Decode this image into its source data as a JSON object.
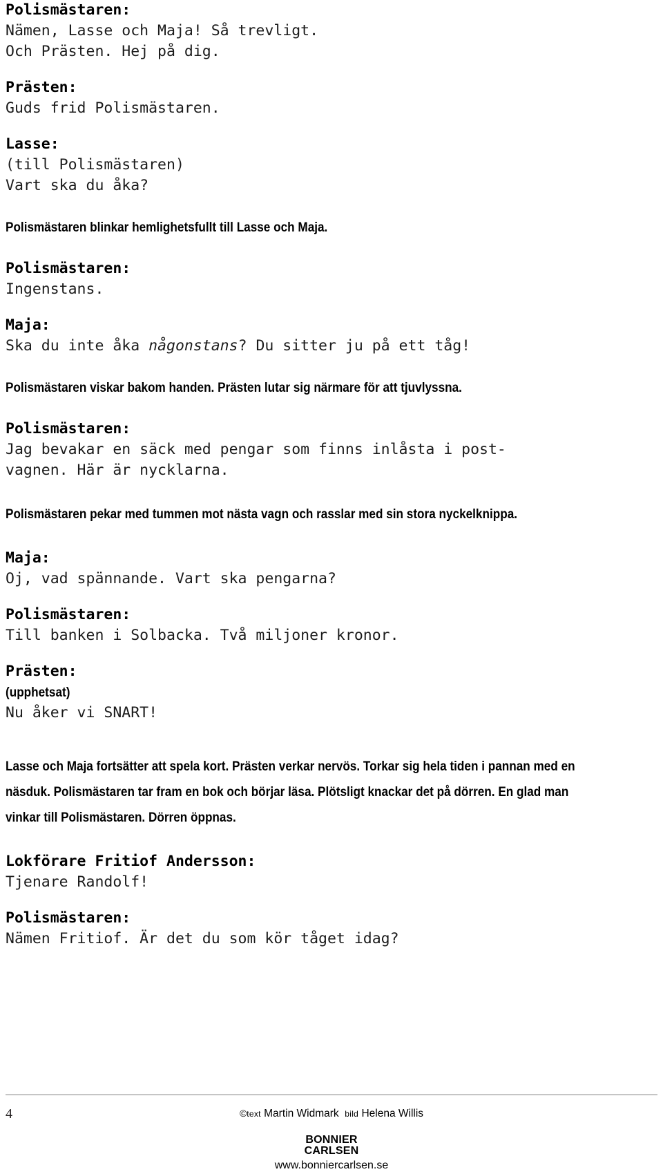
{
  "document": {
    "blocks": [
      {
        "kind": "speaker",
        "text": "Polismästaren:"
      },
      {
        "kind": "line",
        "text": "Nämen, Lasse och Maja! Så trevligt."
      },
      {
        "kind": "line",
        "text": "Och Prästen. Hej på dig."
      },
      {
        "kind": "speaker",
        "text": "Prästen:"
      },
      {
        "kind": "line",
        "text": "Guds frid Polismästaren."
      },
      {
        "kind": "speaker",
        "text": "Lasse:"
      },
      {
        "kind": "line",
        "text": "(till Polismästaren)"
      },
      {
        "kind": "line",
        "text": "Vart ska du åka?"
      },
      {
        "kind": "stage",
        "text": "Polismästaren blinkar hemlighetsfullt till Lasse och Maja."
      },
      {
        "kind": "speaker",
        "text": "Polismästaren:"
      },
      {
        "kind": "line",
        "text": "Ingenstans."
      },
      {
        "kind": "speaker",
        "text": "Maja:"
      },
      {
        "kind": "line_italic",
        "pre": "Ska du inte åka ",
        "em": "någonstans",
        "post": "? Du sitter ju på ett tåg!"
      },
      {
        "kind": "stage",
        "text": "Polismästaren viskar bakom handen. Prästen lutar sig närmare för att tjuvlyssna."
      },
      {
        "kind": "speaker",
        "text": "Polismästaren:"
      },
      {
        "kind": "line",
        "text": "Jag bevakar en säck med pengar som finns inlåsta i post-"
      },
      {
        "kind": "line",
        "text": "vagnen. Här är nycklarna."
      },
      {
        "kind": "stage",
        "text": "Polismästaren pekar med tummen mot nästa vagn och rasslar med sin stora nyckelknippa."
      },
      {
        "kind": "speaker",
        "text": "Maja:"
      },
      {
        "kind": "line",
        "text": "Oj, vad spännande. Vart ska pengarna?"
      },
      {
        "kind": "speaker",
        "text": "Polismästaren:"
      },
      {
        "kind": "line",
        "text": "Till banken i Solbacka. Två miljoner kronor."
      },
      {
        "kind": "speaker",
        "text": "Prästen:"
      },
      {
        "kind": "stage",
        "text": "(upphetsat)"
      },
      {
        "kind": "line",
        "text": "Nu åker vi SNART!"
      },
      {
        "kind": "stage",
        "text": "Lasse och Maja fortsätter att spela kort. Prästen verkar nervös. Torkar sig hela tiden i pannan med en näsduk. Polismästaren tar fram en bok och börjar läsa. Plötsligt knackar det på dörren. En glad man vinkar till Polismästaren. Dörren öppnas."
      },
      {
        "kind": "speaker",
        "text": "Lokförare Fritiof Andersson:"
      },
      {
        "kind": "line",
        "text": "Tjenare Randolf!"
      },
      {
        "kind": "speaker",
        "text": "Polismästaren:"
      },
      {
        "kind": "line",
        "text": "Nämen Fritiof. Är det du som kör tåget idag?"
      }
    ]
  },
  "footer": {
    "page_number": "4",
    "copyright_symbol": "©",
    "credit_text_label": "text",
    "credit_text_author": "Martin Widmark",
    "credit_bild_label": "bild",
    "credit_bild_author": "Helena Willis",
    "publisher_line1": "BONNIER",
    "publisher_line2": "CARLSEN",
    "publisher_url": "www.bonniercarlsen.se"
  }
}
